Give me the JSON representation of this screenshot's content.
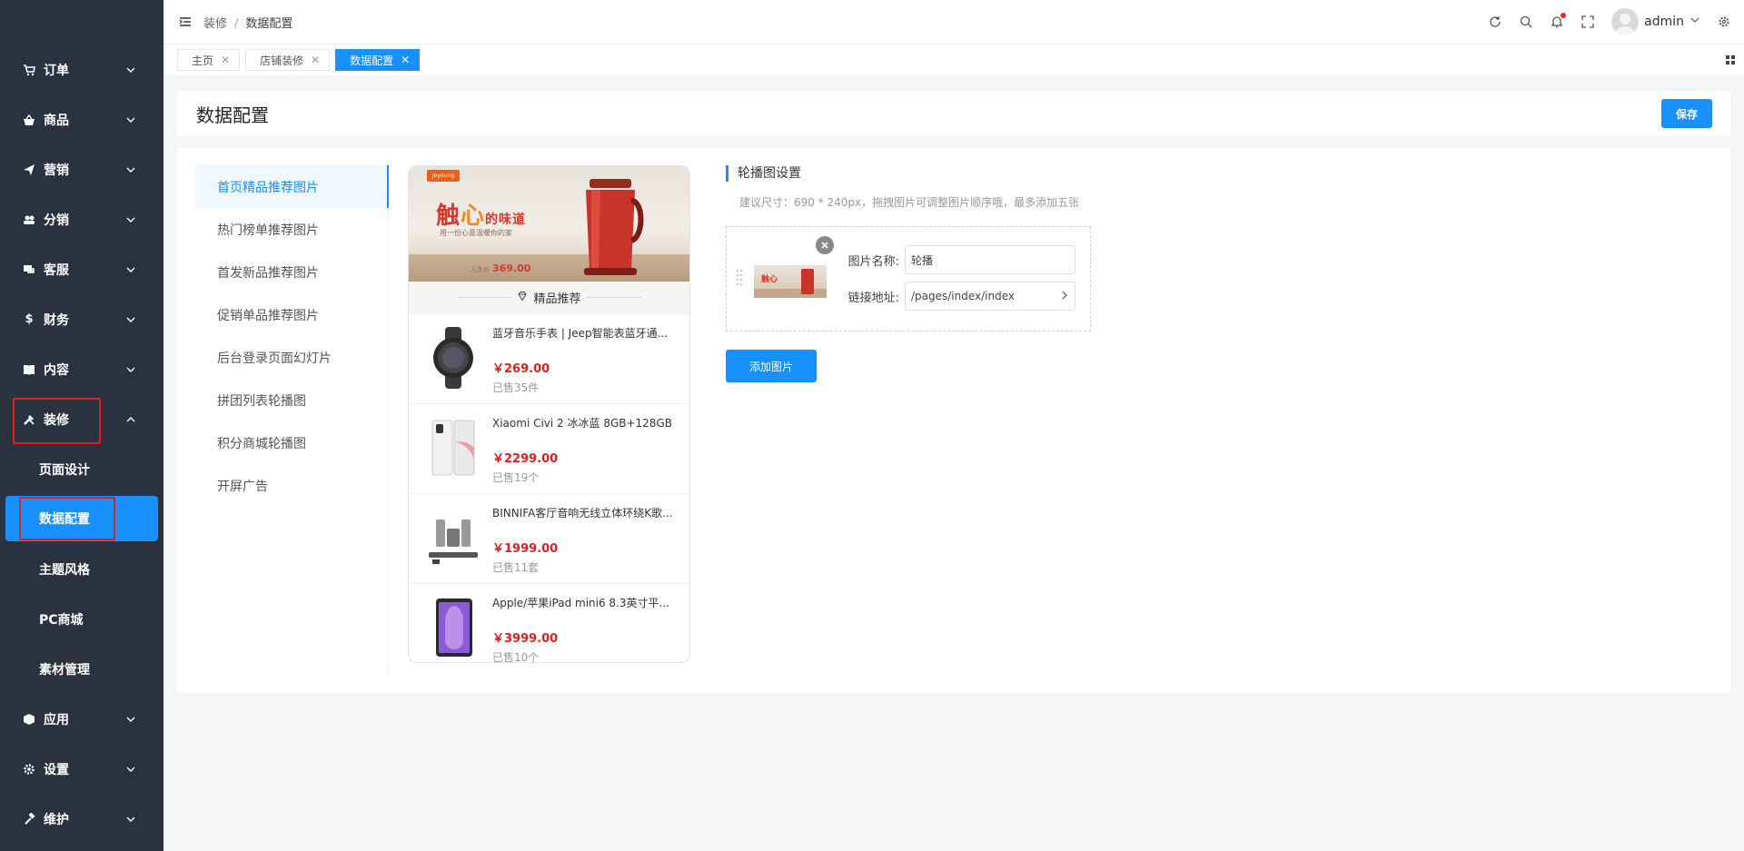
{
  "sidebar": {
    "items": [
      {
        "label": "订单",
        "icon": "cart-icon"
      },
      {
        "label": "商品",
        "icon": "basket-icon"
      },
      {
        "label": "营销",
        "icon": "send-icon"
      },
      {
        "label": "分销",
        "icon": "people-icon"
      },
      {
        "label": "客服",
        "icon": "chat-icon"
      },
      {
        "label": "财务",
        "icon": "dollar-icon"
      },
      {
        "label": "内容",
        "icon": "book-icon"
      },
      {
        "label": "装修",
        "icon": "tools-icon"
      }
    ],
    "sub_items": [
      "页面设计",
      "数据配置",
      "主题风格",
      "PC商城",
      "素材管理"
    ],
    "bottom_items": [
      {
        "label": "应用",
        "icon": "cube-icon"
      },
      {
        "label": "设置",
        "icon": "gear-icon"
      },
      {
        "label": "维护",
        "icon": "hammer-icon"
      }
    ]
  },
  "topbar": {
    "breadcrumb": [
      "装修",
      "数据配置"
    ],
    "separator": "/",
    "username": "admin"
  },
  "tabs": [
    {
      "label": "主页",
      "active": false
    },
    {
      "label": "店铺装修",
      "active": false
    },
    {
      "label": "数据配置",
      "active": true
    }
  ],
  "header": {
    "title": "数据配置",
    "save_label": "保存"
  },
  "left_menu": [
    "首页精品推荐图片",
    "热门榜单推荐图片",
    "首发新品推荐图片",
    "促销单品推荐图片",
    "后台登录页面幻灯片",
    "拼团列表轮播图",
    "积分商城轮播图",
    "开屏广告"
  ],
  "preview": {
    "banner": {
      "brand": "Joyoung",
      "slogan_a": "触",
      "slogan_b": "心",
      "slogan_c": "的味道",
      "sub": "用一份心意温暖你的家",
      "price_prefix": "入手价",
      "price": "369.00"
    },
    "rec_title": "精品推荐",
    "products": [
      {
        "name": "蓝牙音乐手表 | Jeep智能表蓝牙通...",
        "price": "￥269.00",
        "sold": "已售35件",
        "icon": "smartwatch-image"
      },
      {
        "name": "Xiaomi Civi 2 冰冰蓝 8GB+128GB",
        "price": "￥2299.00",
        "sold": "已售19个",
        "icon": "phone-image"
      },
      {
        "name": "BINNIFA客厅音响无线立体环绕K歌...",
        "price": "￥1999.00",
        "sold": "已售11套",
        "icon": "speaker-image"
      },
      {
        "name": "Apple/苹果iPad mini6 8.3英寸平...",
        "price": "￥3999.00",
        "sold": "已售10个",
        "icon": "tablet-image"
      }
    ]
  },
  "config": {
    "section_title": "轮播图设置",
    "hint": "建议尺寸：690 * 240px，拖拽图片可调整图片顺序哦，最多添加五张",
    "name_label": "图片名称:",
    "name_value": "轮播",
    "link_label": "链接地址:",
    "link_value": "/pages/index/index",
    "add_label": "添加图片"
  },
  "colors": {
    "sidebar_bg": "#2b323f",
    "accent": "#1890ff",
    "price": "#e02020",
    "highlight_box": "#e02020"
  }
}
